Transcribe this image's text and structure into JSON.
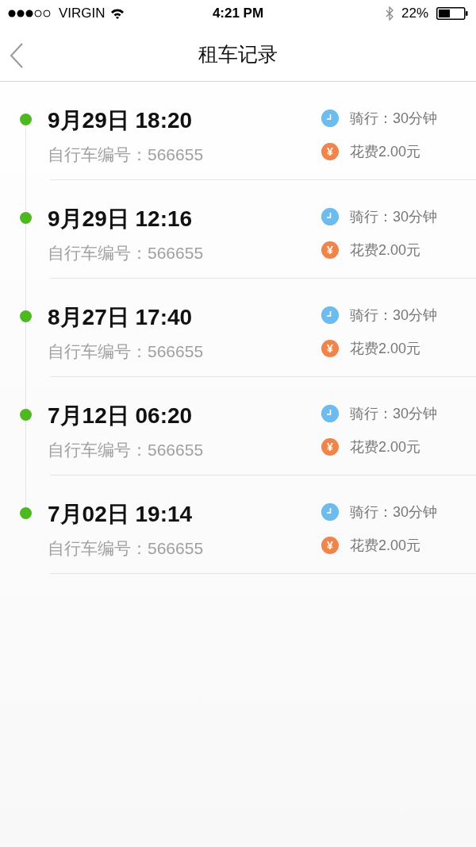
{
  "status_bar": {
    "carrier": "VIRGIN",
    "time": "4:21 PM",
    "battery": "22%"
  },
  "nav": {
    "title": "租车记录"
  },
  "records": [
    {
      "datetime": "9月29日 18:20",
      "bike_id": "自行车编号：566655",
      "duration": "骑行：30分钟",
      "cost_symbol": "¥",
      "cost": "花费2.00元"
    },
    {
      "datetime": "9月29日 12:16",
      "bike_id": "自行车编号：566655",
      "duration": "骑行：30分钟",
      "cost_symbol": "¥",
      "cost": "花费2.00元"
    },
    {
      "datetime": "8月27日 17:40",
      "bike_id": "自行车编号：566655",
      "duration": "骑行：30分钟",
      "cost_symbol": "¥",
      "cost": "花费2.00元"
    },
    {
      "datetime": "7月12日 06:20",
      "bike_id": "自行车编号：566655",
      "duration": "骑行：30分钟",
      "cost_symbol": "¥",
      "cost": "花费2.00元"
    },
    {
      "datetime": "7月02日 19:14",
      "bike_id": "自行车编号：566655",
      "duration": "骑行：30分钟",
      "cost_symbol": "¥",
      "cost": "花费2.00元"
    }
  ]
}
